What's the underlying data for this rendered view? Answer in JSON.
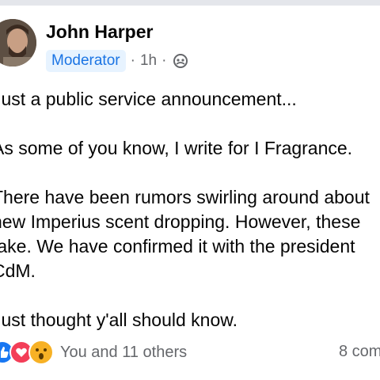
{
  "post": {
    "author": "John Harper",
    "role_badge": "Moderator",
    "separator": "·",
    "time": "1h",
    "audience_icon": "group-icon",
    "paragraphs": [
      {
        "lines": [
          "Just a public service announcement..."
        ]
      },
      {
        "lines": [
          "As some of you know, I write for I Fragrance."
        ]
      },
      {
        "lines": [
          "There have been rumors swirling around about",
          "new Imperius scent dropping. However, these",
          "fake. We have confirmed it with the president",
          "CdM."
        ]
      },
      {
        "lines": [
          "Just thought y'all should know."
        ]
      }
    ]
  },
  "footer": {
    "reaction_icons": [
      "like-icon",
      "love-icon",
      "wow-icon"
    ],
    "reactions_text": "You and 11 others",
    "comments_text": "8 com"
  },
  "colors": {
    "accent": "#1b74e4",
    "badge_bg": "#e7f3ff",
    "muted": "#65676b"
  }
}
